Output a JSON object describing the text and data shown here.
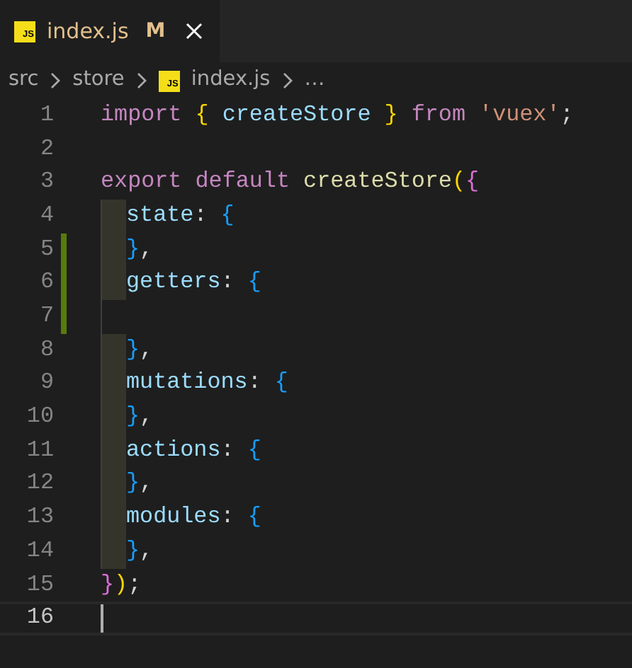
{
  "tabs": [
    {
      "label": "index.js",
      "icon_label": "JS",
      "status": "M",
      "modified": true,
      "selected": true
    }
  ],
  "breadcrumbs": [
    {
      "kind": "folder",
      "label": "src"
    },
    {
      "kind": "folder",
      "label": "store"
    },
    {
      "kind": "file",
      "icon_label": "JS",
      "label": "index.js"
    },
    {
      "kind": "more",
      "label": "…"
    }
  ],
  "lines": [
    {
      "number": "1",
      "added": false,
      "indent": false,
      "current": false,
      "tokens": [
        {
          "kind": "keyword",
          "text": "import"
        },
        {
          "kind": "bracket1",
          "text": " {"
        },
        {
          "kind": "variable",
          "text": " createStore"
        },
        {
          "kind": "bracket1",
          "text": " }"
        },
        {
          "kind": "keyword",
          "text": " from"
        },
        {
          "kind": "string",
          "text": " 'vuex'"
        },
        {
          "kind": "punct",
          "text": ";"
        }
      ]
    },
    {
      "number": "2",
      "added": false,
      "indent": false,
      "current": false
    },
    {
      "number": "3",
      "added": false,
      "indent": false,
      "current": false,
      "tokens": [
        {
          "kind": "keyword",
          "text": "export"
        },
        {
          "kind": "keyword",
          "text": " default"
        },
        {
          "kind": "function",
          "text": " createStore"
        },
        {
          "kind": "bracket1",
          "text": "("
        },
        {
          "kind": "bracket2",
          "text": "{"
        }
      ]
    },
    {
      "number": "4",
      "added": false,
      "indent": true,
      "current": false,
      "tokens": [
        {
          "kind": "variable",
          "text": "state"
        },
        {
          "kind": "punct",
          "text": ":"
        },
        {
          "kind": "bracket3",
          "text": " {"
        }
      ]
    },
    {
      "number": "5",
      "added": true,
      "indent": true,
      "current": false,
      "tokens": [
        {
          "kind": "bracket3",
          "text": "}"
        },
        {
          "kind": "punct",
          "text": ","
        }
      ]
    },
    {
      "number": "6",
      "added": true,
      "indent": true,
      "current": false,
      "tokens": [
        {
          "kind": "variable",
          "text": "getters"
        },
        {
          "kind": "punct",
          "text": ":"
        },
        {
          "kind": "bracket3",
          "text": " {"
        }
      ]
    },
    {
      "number": "7",
      "added": true,
      "indent": false,
      "current": false
    },
    {
      "number": "8",
      "added": false,
      "indent": true,
      "current": false,
      "tokens": [
        {
          "kind": "bracket3",
          "text": "}"
        },
        {
          "kind": "punct",
          "text": ","
        }
      ]
    },
    {
      "number": "9",
      "added": false,
      "indent": true,
      "current": false,
      "tokens": [
        {
          "kind": "variable",
          "text": "mutations"
        },
        {
          "kind": "punct",
          "text": ":"
        },
        {
          "kind": "bracket3",
          "text": " {"
        }
      ]
    },
    {
      "number": "10",
      "added": false,
      "indent": true,
      "current": false,
      "tokens": [
        {
          "kind": "bracket3",
          "text": "}"
        },
        {
          "kind": "punct",
          "text": ","
        }
      ]
    },
    {
      "number": "11",
      "added": false,
      "indent": true,
      "current": false,
      "tokens": [
        {
          "kind": "variable",
          "text": "actions"
        },
        {
          "kind": "punct",
          "text": ":"
        },
        {
          "kind": "bracket3",
          "text": " {"
        }
      ]
    },
    {
      "number": "12",
      "added": false,
      "indent": true,
      "current": false,
      "tokens": [
        {
          "kind": "bracket3",
          "text": "}"
        },
        {
          "kind": "punct",
          "text": ","
        }
      ]
    },
    {
      "number": "13",
      "added": false,
      "indent": true,
      "current": false,
      "tokens": [
        {
          "kind": "variable",
          "text": "modules"
        },
        {
          "kind": "punct",
          "text": ":"
        },
        {
          "kind": "bracket3",
          "text": " {"
        }
      ]
    },
    {
      "number": "14",
      "added": false,
      "indent": true,
      "current": false,
      "tokens": [
        {
          "kind": "bracket3",
          "text": "}"
        },
        {
          "kind": "punct",
          "text": ","
        }
      ]
    },
    {
      "number": "15",
      "added": false,
      "indent": false,
      "current": false,
      "tokens": [
        {
          "kind": "bracket2",
          "text": "}"
        },
        {
          "kind": "bracket1",
          "text": ")"
        },
        {
          "kind": "punct",
          "text": ";"
        }
      ]
    },
    {
      "number": "16",
      "added": false,
      "indent": false,
      "current": true
    }
  ]
}
